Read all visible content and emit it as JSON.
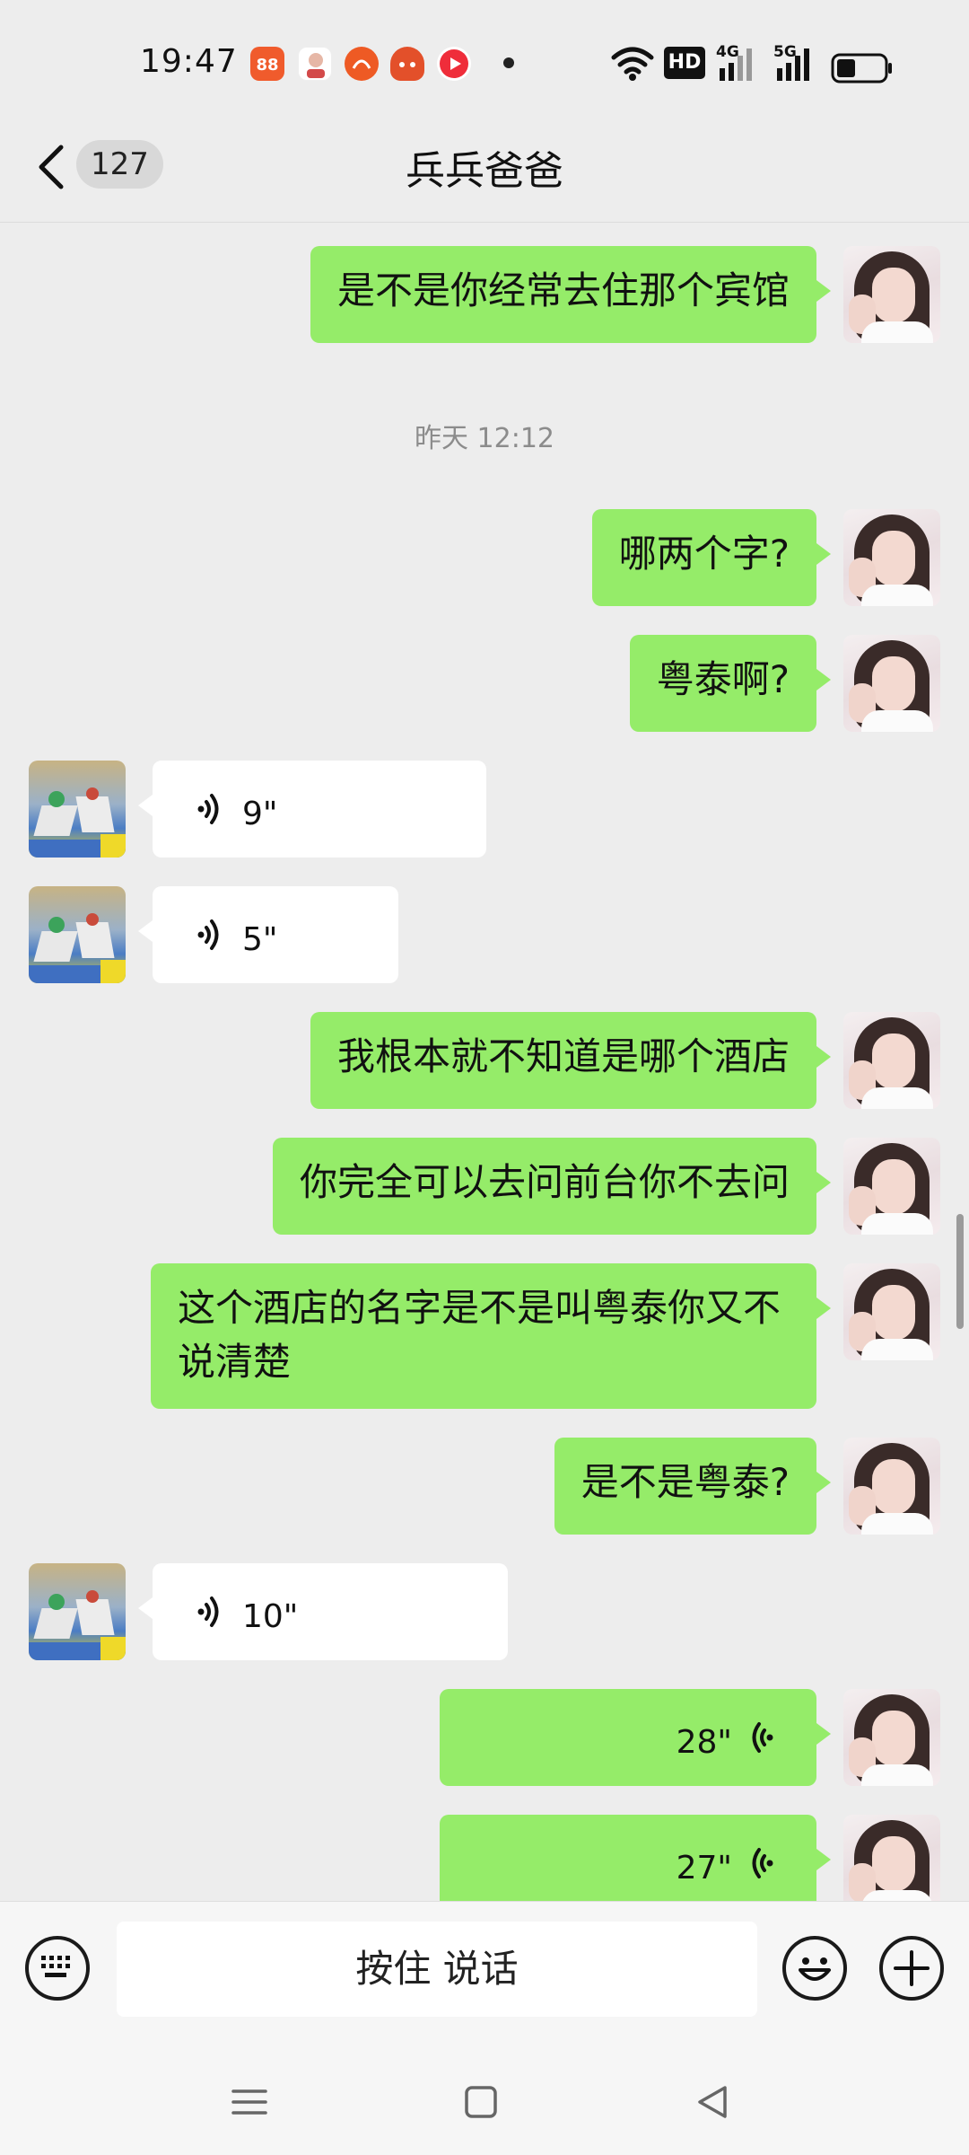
{
  "status_bar": {
    "time": "19:47",
    "network_badge": "HD",
    "signal_1": "4G",
    "signal_2": "5G",
    "notification_icons": [
      "pinduoduo-icon",
      "contact-app-icon",
      "taobao-icon",
      "game-app-icon",
      "video-app-icon"
    ]
  },
  "header": {
    "unread_count": "127",
    "title": "兵兵爸爸"
  },
  "messages": [
    {
      "side": "out",
      "type": "text",
      "text": "是不是你经常去住那个宾馆"
    },
    {
      "type": "timestamp",
      "text": "昨天 12:12"
    },
    {
      "side": "out",
      "type": "text",
      "text": "哪两个字?"
    },
    {
      "side": "out",
      "type": "text",
      "text": "粤泰啊?"
    },
    {
      "side": "in",
      "type": "voice",
      "duration": "9\""
    },
    {
      "side": "in",
      "type": "voice",
      "duration": "5\""
    },
    {
      "side": "out",
      "type": "text",
      "text": "我根本就不知道是哪个酒店"
    },
    {
      "side": "out",
      "type": "text",
      "text": "你完全可以去问前台你不去问"
    },
    {
      "side": "out",
      "type": "text",
      "text": "这个酒店的名字是不是叫粤泰你又不说清楚"
    },
    {
      "side": "out",
      "type": "text",
      "text": "是不是粤泰?"
    },
    {
      "side": "in",
      "type": "voice",
      "duration": "10\""
    },
    {
      "side": "out",
      "type": "voice",
      "duration": "28\""
    },
    {
      "side": "out",
      "type": "voice",
      "duration": "27\""
    }
  ],
  "input_bar": {
    "hold_to_talk_label": "按住 说话"
  },
  "colors": {
    "outgoing_bubble": "#95ec69",
    "incoming_bubble": "#ffffff",
    "background": "#ededed"
  }
}
